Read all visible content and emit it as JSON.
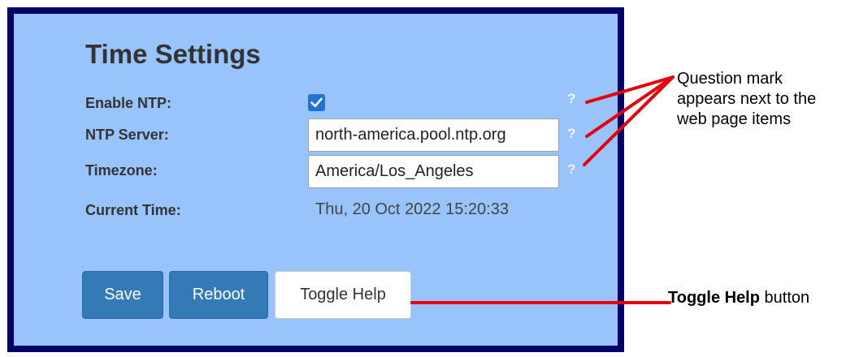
{
  "settings": {
    "title": "Time Settings",
    "enable_ntp": {
      "label": "Enable NTP:",
      "checked": true
    },
    "ntp_server": {
      "label": "NTP Server:",
      "value": "north-america.pool.ntp.org"
    },
    "timezone": {
      "label": "Timezone:",
      "value": "America/Los_Angeles"
    },
    "current_time": {
      "label": "Current Time:",
      "value": "Thu, 20 Oct 2022 15:20:33"
    },
    "help_mark": "?"
  },
  "buttons": {
    "save": "Save",
    "reboot": "Reboot",
    "toggle_help": "Toggle Help"
  },
  "annotations": {
    "question_mark_note": [
      "Question mark",
      "appears next to the",
      "web page items"
    ],
    "toggle_note_bold": "Toggle Help",
    "toggle_note_rest": " button",
    "arrow_color": "#e8000b"
  },
  "colors": {
    "frame": "#00006b",
    "panel": "#98c4fb",
    "primary_button": "#347ab7",
    "checkbox": "#1f72d6"
  }
}
